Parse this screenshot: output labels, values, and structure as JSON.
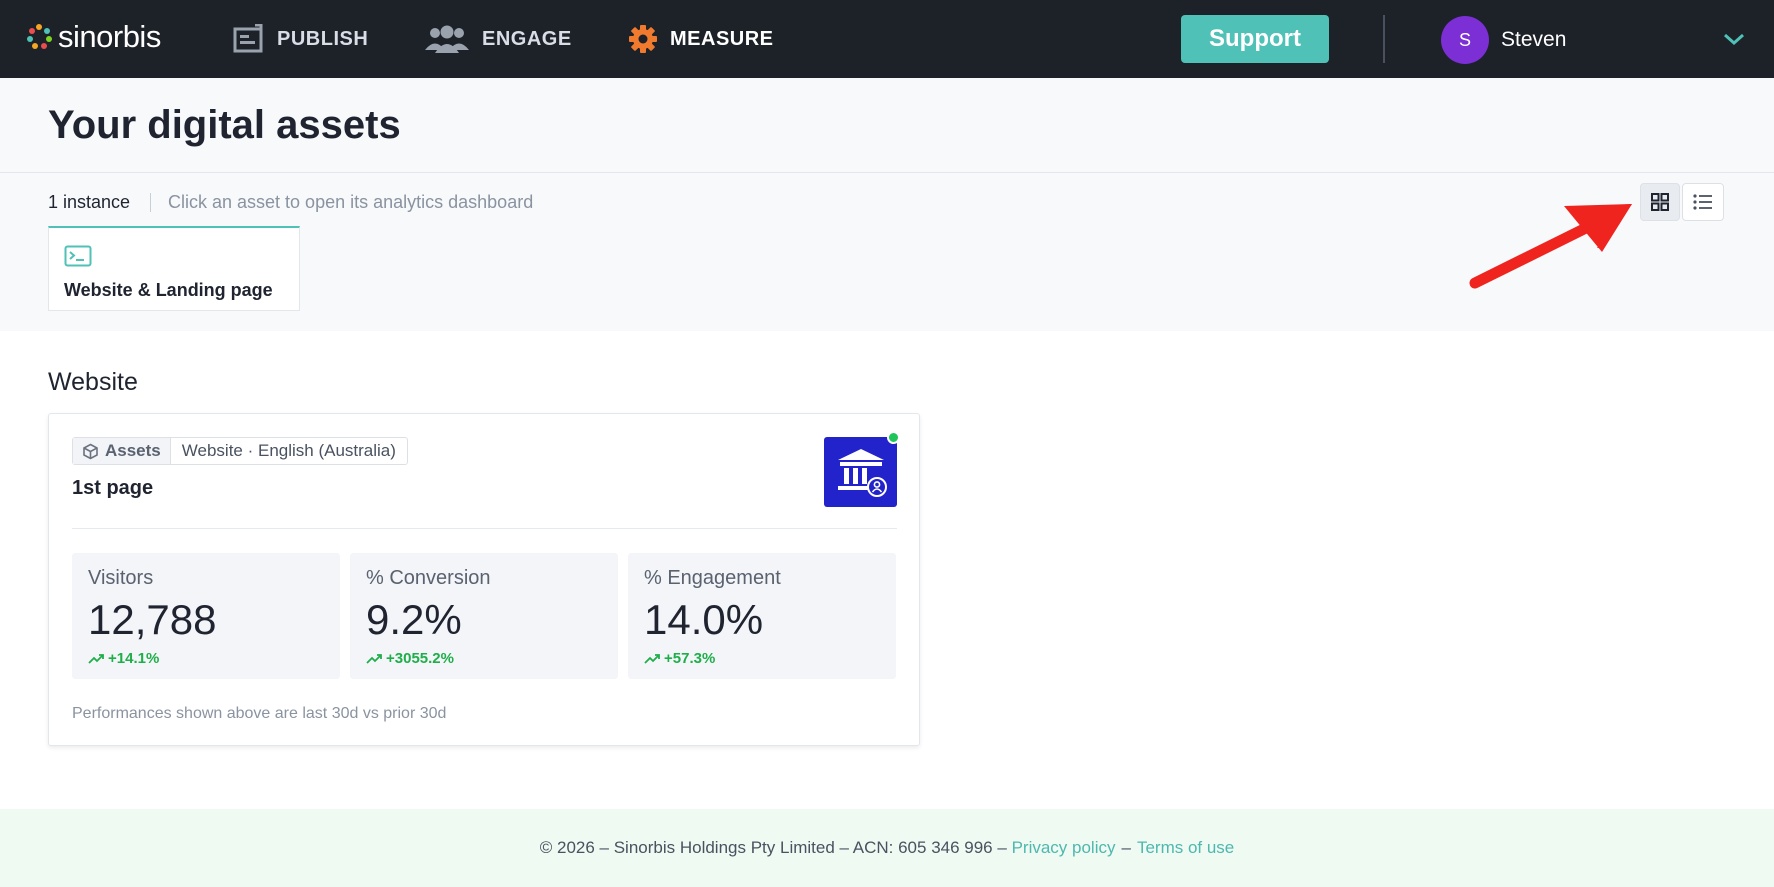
{
  "nav": {
    "brand": "sinorbis",
    "items": [
      {
        "label": "PUBLISH",
        "icon": "publish-icon"
      },
      {
        "label": "ENGAGE",
        "icon": "users-icon"
      },
      {
        "label": "MEASURE",
        "icon": "gear-icon",
        "active": true
      }
    ],
    "support_label": "Support",
    "user": {
      "initial": "S",
      "name": "Steven"
    }
  },
  "header": {
    "title": "Your digital assets",
    "instance_count": "1 instance",
    "hint": "Click an asset to open its analytics dashboard",
    "asset_tab_label": "Website & Landing page"
  },
  "section": {
    "title": "Website",
    "card": {
      "tag_label": "Assets",
      "tag_meta": "Website · English (Australia)",
      "title": "1st page",
      "status": "online",
      "metrics": [
        {
          "label": "Visitors",
          "value": "12,788",
          "delta": "+14.1%"
        },
        {
          "label": "% Conversion",
          "value": "9.2%",
          "delta": "+3055.2%"
        },
        {
          "label": "% Engagement",
          "value": "14.0%",
          "delta": "+57.3%"
        }
      ],
      "note": "Performances shown above are last 30d vs prior 30d"
    }
  },
  "footer": {
    "copyright": "© 2026 – Sinorbis Holdings Pty Limited – ACN: 605 346 996 –",
    "privacy": "Privacy policy",
    "separator": "–",
    "terms": "Terms of use"
  },
  "colors": {
    "accent": "#4fc1b7",
    "nav_bg": "#1d2128",
    "avatar": "#7b2fd4",
    "positive": "#1fae4a",
    "asset_thumb": "#2323cc",
    "annotation_arrow": "#f0241f"
  }
}
